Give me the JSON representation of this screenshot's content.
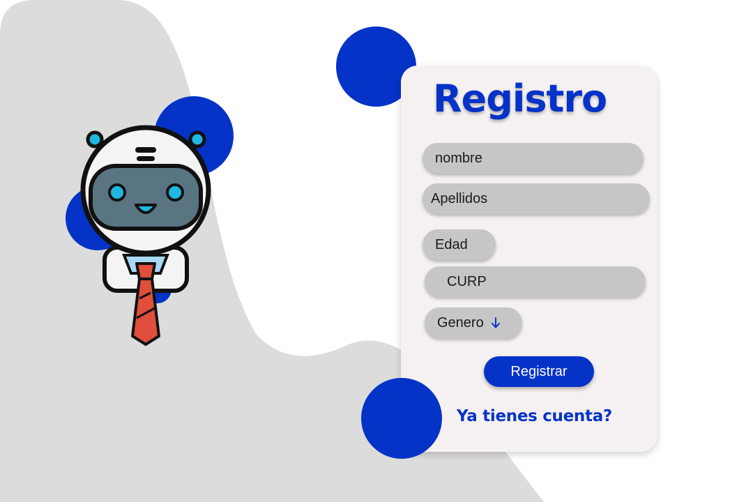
{
  "colors": {
    "accent": "#0533c8",
    "card_background": "#f6f1f1",
    "field_background": "#c6c6c6",
    "blob_background": "#dcdcdc"
  },
  "illustration": {
    "icon": "robot-with-tie-icon"
  },
  "form": {
    "title": "Registro",
    "fields": {
      "nombre": {
        "placeholder": "nombre"
      },
      "apellidos": {
        "placeholder": "Apellidos"
      },
      "edad": {
        "placeholder": "Edad"
      },
      "curp": {
        "placeholder": "CURP"
      },
      "genero": {
        "label": "Genero",
        "icon": "arrow-down-icon"
      }
    },
    "submit_label": "Registrar",
    "login_link": "Ya tienes cuenta?"
  }
}
